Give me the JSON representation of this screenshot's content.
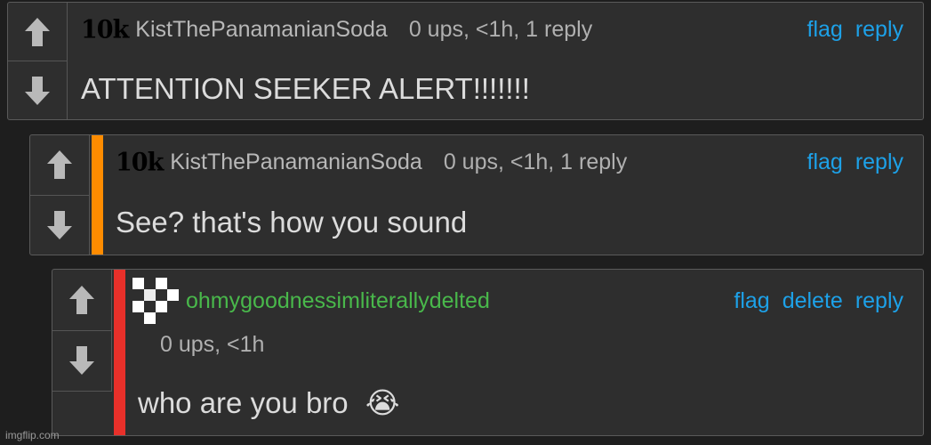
{
  "comments": [
    {
      "rank": "10k",
      "username": "KistThePanamanianSoda",
      "meta": "0 ups, <1h, 1 reply",
      "actions": [
        "flag",
        "reply"
      ],
      "text": "ATTENTION SEEKER ALERT!!!!!!!"
    },
    {
      "rank": "10k",
      "username": "KistThePanamanianSoda",
      "meta": "0 ups, <1h, 1 reply",
      "actions": [
        "flag",
        "reply"
      ],
      "text": "See? that's how you sound",
      "stripe_color": "#ff8c00"
    },
    {
      "username": "ohmygoodnessimliterallydelted",
      "meta": "0 ups, <1h",
      "actions": [
        "flag",
        "delete",
        "reply"
      ],
      "text": "who are you bro",
      "emoji": "😭",
      "stripe_color": "#e8302a"
    }
  ],
  "watermark": "imgflip.com",
  "colors": {
    "link": "#1da1e8",
    "op_username": "#49b84b",
    "reply_stripe": "#ff8c00",
    "nested_stripe": "#e8302a"
  }
}
